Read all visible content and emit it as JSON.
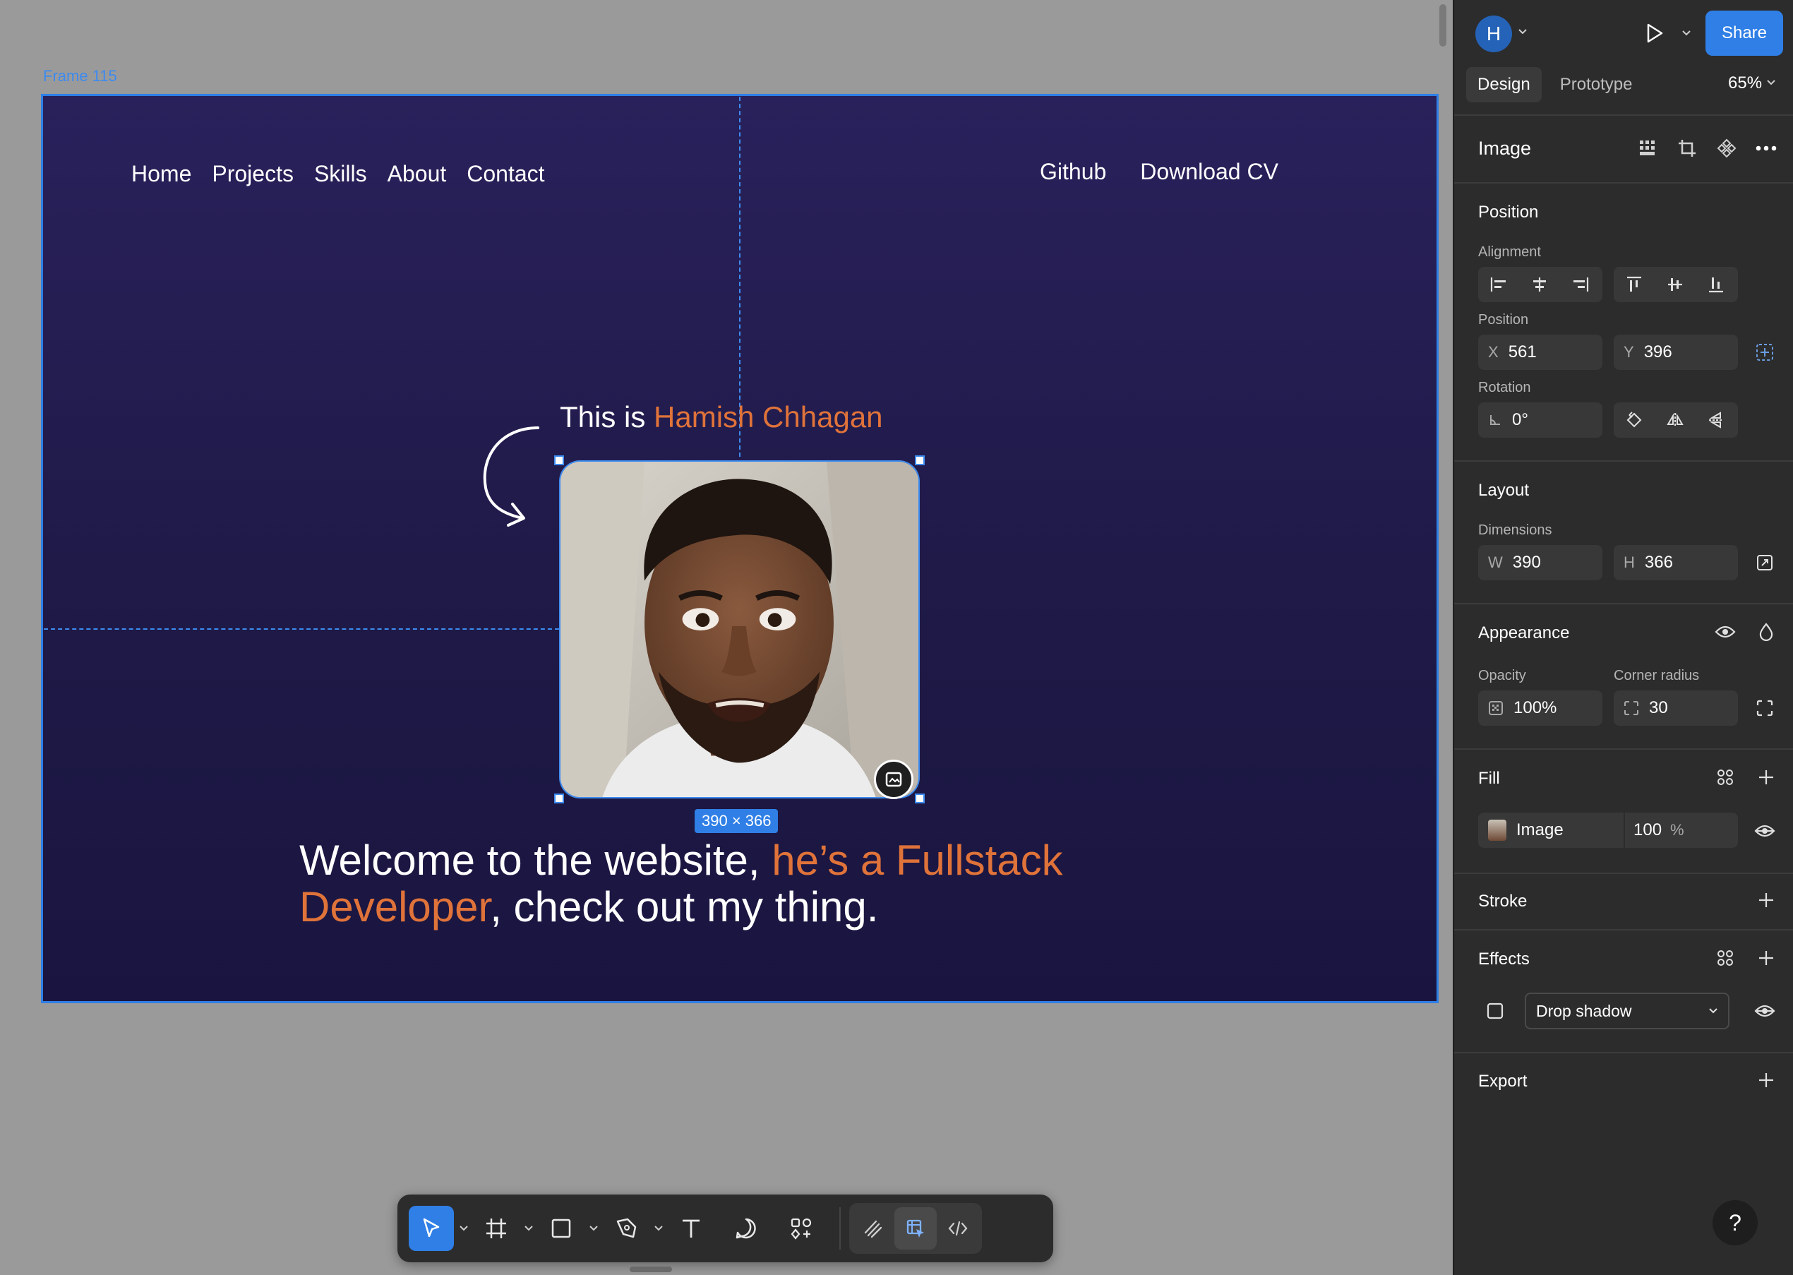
{
  "canvas": {
    "frame_label": "Frame 115",
    "nav_left": [
      "Home",
      "Projects",
      "Skills",
      "About",
      "Contact"
    ],
    "nav_right": [
      "Github",
      "Download CV"
    ],
    "intro_prefix": "This is ",
    "intro_name": "Hamish Chhagan",
    "dimension_tag": "390 × 366",
    "headline_white_1": "Welcome to the website, ",
    "headline_orange": "he’s a Fullstack Developer",
    "headline_white_2": ", check out my thing.",
    "colors": {
      "frame_bg": "#29215b",
      "accent": "#e0733a",
      "selection": "#2f7fe6"
    }
  },
  "toolbar": {
    "tools": [
      "move-icon",
      "frame-icon",
      "rectangle-icon",
      "pen-icon",
      "text-icon",
      "comment-icon",
      "components-icon"
    ],
    "mode_tools": [
      "draw-icon",
      "design-icon",
      "dev-mode-icon"
    ]
  },
  "panel": {
    "avatar_initial": "H",
    "share_label": "Share",
    "tabs": [
      "Design",
      "Prototype"
    ],
    "zoom": "65%",
    "layer_type": "Image",
    "position": {
      "title": "Position",
      "alignment_label": "Alignment",
      "position_label": "Position",
      "x_label": "X",
      "x_value": "561",
      "y_label": "Y",
      "y_value": "396",
      "rotation_label": "Rotation",
      "rotation_value": "0°"
    },
    "layout": {
      "title": "Layout",
      "dimensions_label": "Dimensions",
      "w_label": "W",
      "w_value": "390",
      "h_label": "H",
      "h_value": "366"
    },
    "appearance": {
      "title": "Appearance",
      "opacity_label": "Opacity",
      "opacity_value": "100%",
      "radius_label": "Corner radius",
      "radius_value": "30"
    },
    "fill": {
      "title": "Fill",
      "type": "Image",
      "opacity": "100",
      "percent": "%"
    },
    "stroke": {
      "title": "Stroke"
    },
    "effects": {
      "title": "Effects",
      "effect_type": "Drop shadow"
    },
    "export": {
      "title": "Export"
    },
    "help": "?"
  }
}
